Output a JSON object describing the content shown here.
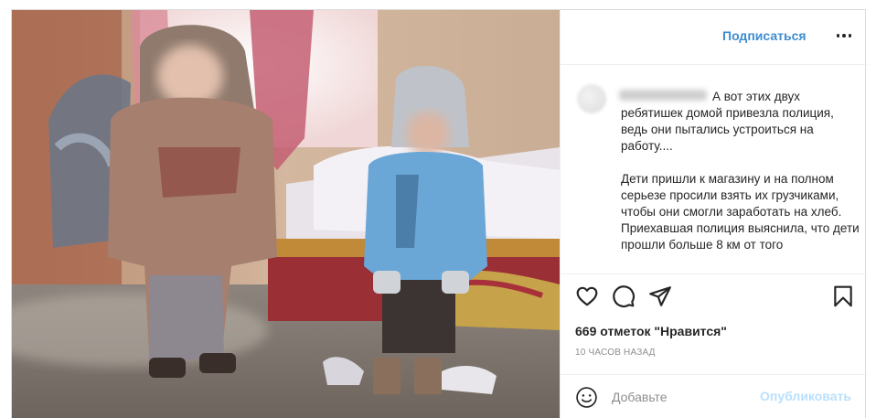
{
  "header": {
    "follow_label": "Подписаться",
    "more_icon": "more-horizontal-icon"
  },
  "caption": {
    "line1": "А вот этих двух ребятишек домой привезла полиция, ведь они пытались устроиться на работу....",
    "line2": "Дети пришли к магазину и на полном серьезе просили взять их грузчиками, чтобы они смогли заработать на хлеб.",
    "line3": "Приехавшая полиция выяснила, что дети прошли больше 8 км от того"
  },
  "actions": {
    "icons": [
      "heart-icon",
      "comment-icon",
      "share-icon",
      "bookmark-icon"
    ],
    "likes_text": "669 отметок \"Нравится\"",
    "timestamp": "10 часов назад"
  },
  "comment": {
    "placeholder": "Добавьте",
    "publish_label": "Опубликовать"
  },
  "colors": {
    "accent": "#3d8ccf",
    "publish_disabled": "#b9dffc",
    "border": "#efefef",
    "muted": "#8e8e8e"
  }
}
